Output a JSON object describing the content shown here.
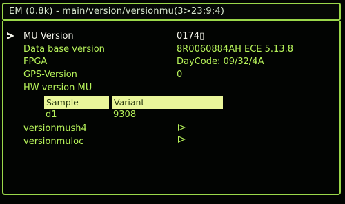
{
  "window": {
    "title": "EM (0.8k) - main/version/versionmu(3>23:9:4)"
  },
  "colors": {
    "frame": "#9bd84a",
    "text": "#b6f25a",
    "selected_text": "#f4f4ea",
    "header_bg": "#eaf69a"
  },
  "menu": {
    "selected_index": 0,
    "items": [
      {
        "label": "MU Version",
        "value": "0174▯"
      },
      {
        "label": "Data base version",
        "value": "8R0060884AH ECE 5.13.8"
      },
      {
        "label": "FPGA",
        "value": "DayCode: 09/32/4A"
      },
      {
        "label": "GPS-Version",
        "value": "0"
      },
      {
        "label": "HW version MU",
        "value": ""
      }
    ]
  },
  "hw_table": {
    "columns": [
      "Sample",
      "Variant"
    ],
    "rows": [
      [
        "d1",
        "9308"
      ]
    ]
  },
  "submenus": [
    {
      "label": "versionmush4",
      "icon": "play-arrow-icon"
    },
    {
      "label": "versionmuloc",
      "icon": "play-arrow-icon"
    }
  ]
}
